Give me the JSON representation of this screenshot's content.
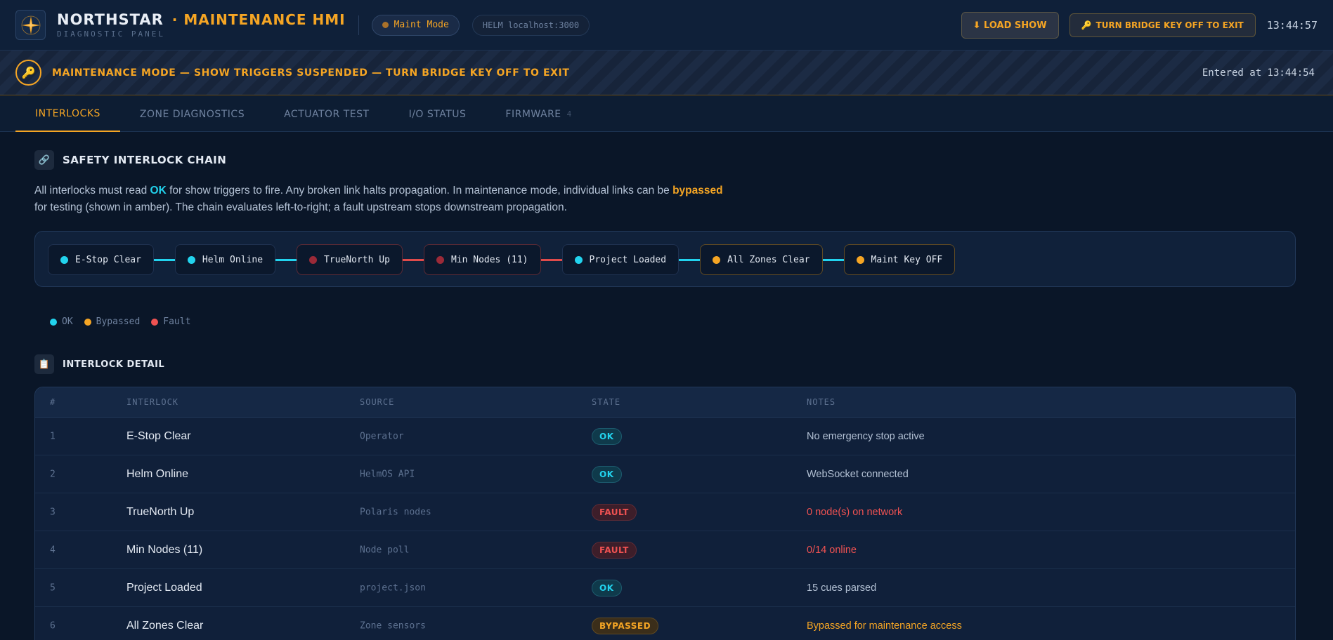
{
  "header": {
    "brand": "NORTHSTAR",
    "subtitle": "· MAINTENANCE HMI",
    "tagline": "DIAGNOSTIC PANEL",
    "mode_pill": "Maint Mode",
    "helm_pill": "HELM localhost:3000",
    "load_button": "⬇ LOAD SHOW",
    "key_button": "TURN BRIDGE KEY OFF TO EXIT",
    "clock": "13:44:57"
  },
  "banner": {
    "message": "MAINTENANCE MODE — SHOW TRIGGERS SUSPENDED — TURN BRIDGE KEY OFF TO EXIT",
    "entered": "Entered at 13:44:54"
  },
  "tabs": [
    {
      "label": "INTERLOCKS",
      "active": true
    },
    {
      "label": "ZONE DIAGNOSTICS"
    },
    {
      "label": "ACTUATOR TEST"
    },
    {
      "label": "I/O STATUS"
    },
    {
      "label": "FIRMWARE",
      "count": "4"
    }
  ],
  "chain_section": {
    "title": "SAFETY INTERLOCK CHAIN",
    "desc_1": "All interlocks must read ",
    "desc_ok": "OK",
    "desc_2": " for show triggers to fire. Any broken link halts propagation. In maintenance mode, individual links can be ",
    "desc_bypassed": "bypassed",
    "desc_3": " for testing (shown in amber). The chain evaluates left-to-right; a fault upstream stops downstream propagation."
  },
  "chain": [
    {
      "label": "E-Stop Clear",
      "state": "ok"
    },
    {
      "label": "Helm Online",
      "state": "ok"
    },
    {
      "label": "TrueNorth Up",
      "state": "fault"
    },
    {
      "label": "Min Nodes (11)",
      "state": "fault"
    },
    {
      "label": "Project Loaded",
      "state": "ok"
    },
    {
      "label": "All Zones Clear",
      "state": "bypass"
    },
    {
      "label": "Maint Key OFF",
      "state": "bypass"
    }
  ],
  "links": [
    "ok",
    "ok",
    "fault",
    "fault",
    "ok",
    "ok"
  ],
  "legend": {
    "ok": "OK",
    "bypassed": "Bypassed",
    "fault": "Fault"
  },
  "colors": {
    "ok": "#22d3ee",
    "bypass": "#f5a524",
    "fault": "#f05252"
  },
  "detail_section": {
    "title": "INTERLOCK DETAIL"
  },
  "table": {
    "headers": [
      "#",
      "INTERLOCK",
      "SOURCE",
      "STATE",
      "NOTES"
    ],
    "rows": [
      {
        "n": "1",
        "name": "E-Stop Clear",
        "source": "Operator",
        "state": "OK",
        "kind": "ok",
        "notes": "No emergency stop active"
      },
      {
        "n": "2",
        "name": "Helm Online",
        "source": "HelmOS API",
        "state": "OK",
        "kind": "ok",
        "notes": "WebSocket connected"
      },
      {
        "n": "3",
        "name": "TrueNorth Up",
        "source": "Polaris nodes",
        "state": "FAULT",
        "kind": "fault",
        "notes": "0 node(s) on network"
      },
      {
        "n": "4",
        "name": "Min Nodes (11)",
        "source": "Node poll",
        "state": "FAULT",
        "kind": "fault",
        "notes": "0/14 online"
      },
      {
        "n": "5",
        "name": "Project Loaded",
        "source": "project.json",
        "state": "OK",
        "kind": "ok",
        "notes": "15 cues parsed"
      },
      {
        "n": "6",
        "name": "All Zones Clear",
        "source": "Zone sensors",
        "state": "BYPASSED",
        "kind": "bypass",
        "notes": "Bypassed for maintenance access"
      }
    ]
  }
}
